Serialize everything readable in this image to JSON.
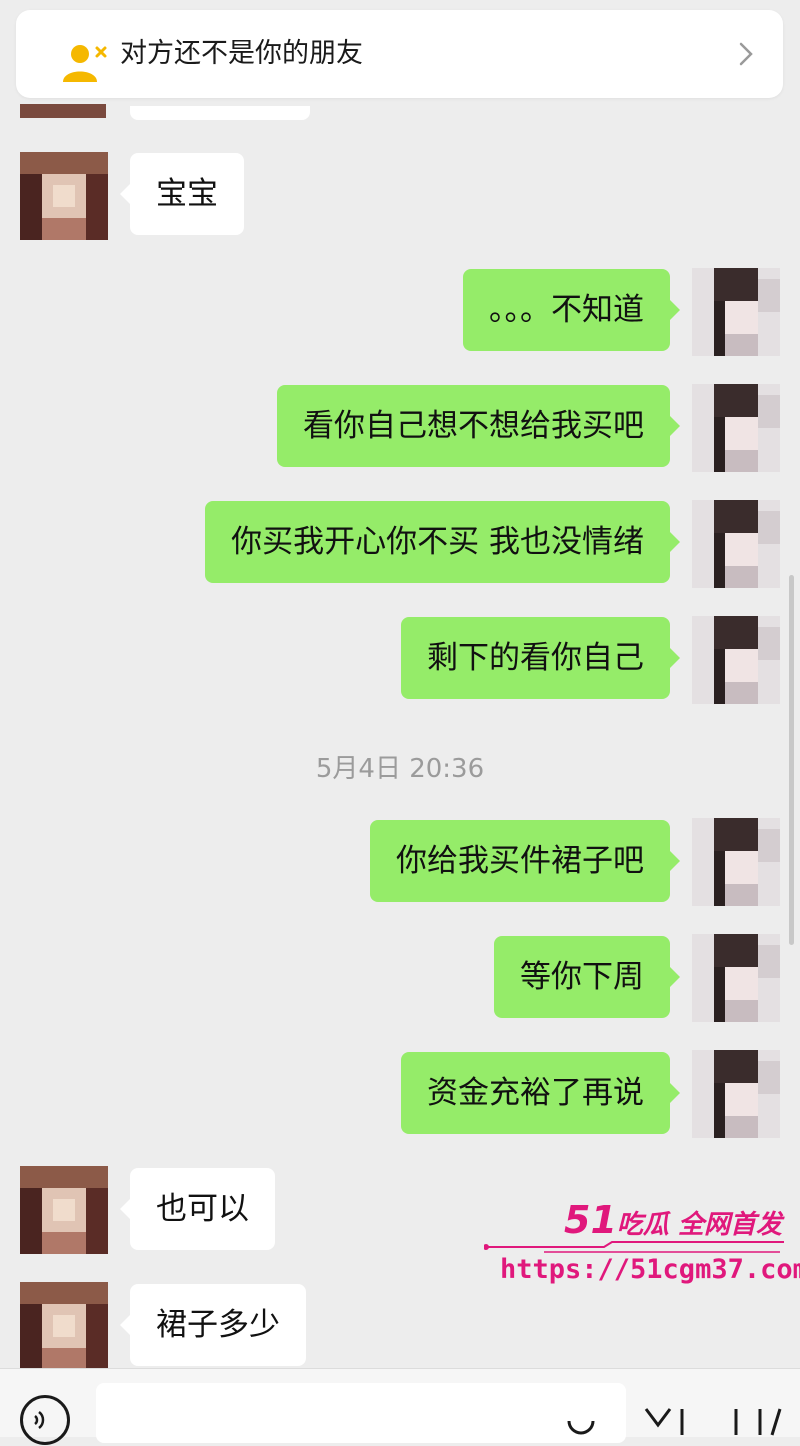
{
  "notice": {
    "text": "对方还不是你的朋友",
    "icon": "user-remove-icon",
    "accent": "#f5b800"
  },
  "messages": [
    {
      "side": "in",
      "text": "宝宝"
    },
    {
      "side": "out",
      "text": "。。。不知道"
    },
    {
      "side": "out",
      "text": "看你自己想不想给我买吧"
    },
    {
      "side": "out",
      "text": "你买我开心你不买 我也没情绪"
    },
    {
      "side": "out",
      "text": "剩下的看你自己"
    },
    {
      "side": "out",
      "text": "你给我买件裙子吧"
    },
    {
      "side": "out",
      "text": "等你下周"
    },
    {
      "side": "out",
      "text": "资金充裕了再说"
    },
    {
      "side": "in",
      "text": "也可以"
    },
    {
      "side": "in",
      "text": "裙子多少"
    }
  ],
  "timestamp": "5月4日 20:36",
  "watermark": {
    "num": "51",
    "title": "吃瓜 全网首发",
    "url": "https://51cgm37.com",
    "color": "#e0187c"
  },
  "colors": {
    "background": "#ededed",
    "outgoing_bubble": "#95ec69",
    "incoming_bubble": "#ffffff"
  }
}
